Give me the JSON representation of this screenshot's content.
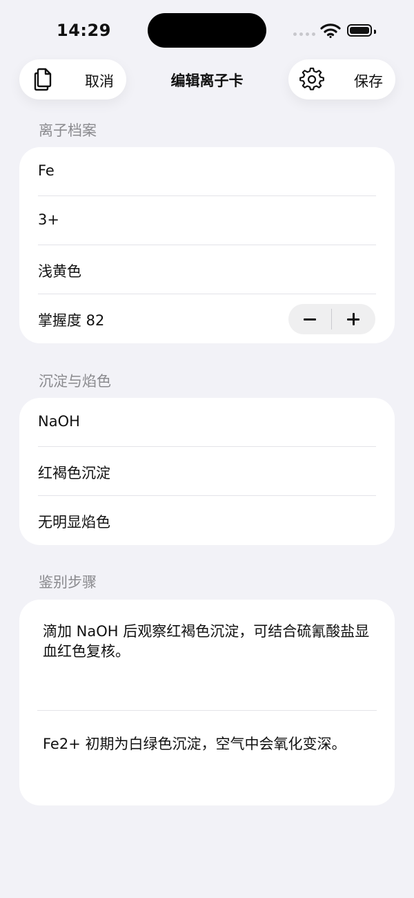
{
  "status_bar": {
    "time": "14:29"
  },
  "nav": {
    "cancel_label": "取消",
    "title": "编辑离子卡",
    "save_label": "保存"
  },
  "profile": {
    "header": "离子档案",
    "element": "Fe",
    "charge": "3+",
    "color": "浅黄色",
    "mastery_label": "掌握度 82"
  },
  "reactions": {
    "header": "沉淀与焰色",
    "reagent": "NaOH",
    "precipitate": "红褐色沉淀",
    "flame": "无明显焰色"
  },
  "steps": {
    "header": "鉴别步骤",
    "note1": "滴加 NaOH 后观察红褐色沉淀，可结合硫氰酸盐显血红色复核。",
    "note2": "Fe2+ 初期为白绿色沉淀，空气中会氧化变深。"
  },
  "icons": {
    "copy": "copy-icon",
    "settings": "gear-icon",
    "decrement": "minus-icon",
    "increment": "plus-icon"
  },
  "colors": {
    "background": "#f2f2f7",
    "card": "#ffffff",
    "section_header": "#8a8a8e",
    "stepper": "#efeff0"
  }
}
